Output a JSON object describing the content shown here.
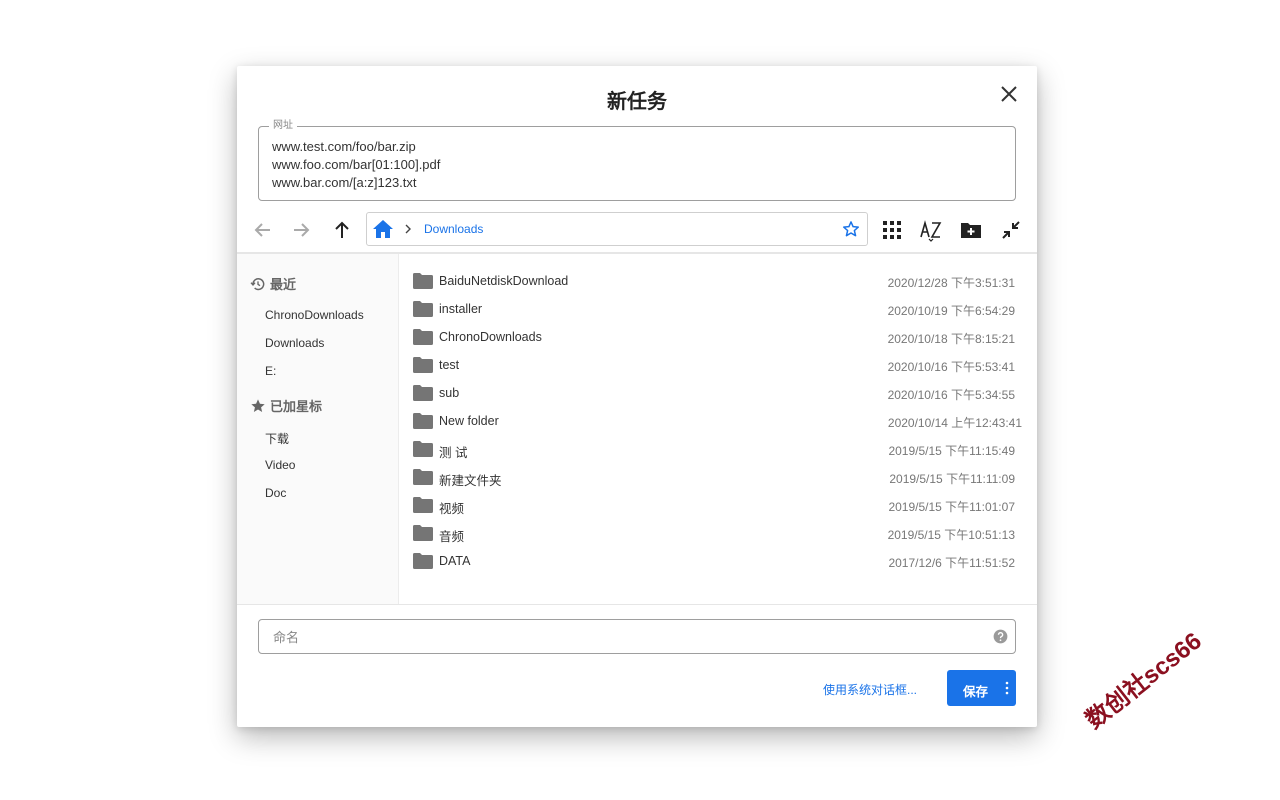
{
  "dialog": {
    "title": "新任务",
    "url_field": {
      "legend": "网址",
      "value": "www.test.com/foo/bar.zip\nwww.foo.com/bar[01:100].pdf\nwww.bar.com/[a:z]123.txt"
    },
    "path": {
      "segments": [
        "Downloads"
      ]
    },
    "icons": {
      "back": "arrow-left-icon",
      "forward": "arrow-right-icon",
      "up": "arrow-up-icon",
      "home": "home-icon",
      "star": "star-outline-icon",
      "grid": "grid-view-icon",
      "sort": "sort-az-icon",
      "new_folder": "new-folder-icon",
      "collapse": "collapse-icon",
      "close": "close-icon",
      "help": "help-circle-icon",
      "more": "more-vertical-icon"
    },
    "sidebar": {
      "recent_heading": "最近",
      "recent_items": [
        "ChronoDownloads",
        "Downloads",
        "E:"
      ],
      "starred_heading": "已加星标",
      "starred_items": [
        "下载",
        "Video",
        "Doc"
      ]
    },
    "files": [
      {
        "name": "BaiduNetdiskDownload",
        "date": "2020/12/28 下午3:51:31"
      },
      {
        "name": "installer",
        "date": "2020/10/19 下午6:54:29"
      },
      {
        "name": "ChronoDownloads",
        "date": "2020/10/18 下午8:15:21"
      },
      {
        "name": "test",
        "date": "2020/10/16 下午5:53:41"
      },
      {
        "name": "sub",
        "date": "2020/10/16 下午5:34:55"
      },
      {
        "name": "New folder",
        "date": "2020/10/14 上午12:43:41"
      },
      {
        "name": "测 试",
        "date": "2019/5/15 下午11:15:49"
      },
      {
        "name": "新建文件夹",
        "date": "2019/5/15 下午11:11:09"
      },
      {
        "name": "视频",
        "date": "2019/5/15 下午11:01:07"
      },
      {
        "name": "音频",
        "date": "2019/5/15 下午10:51:13"
      },
      {
        "name": "DATA",
        "date": "2017/12/6 下午11:51:52"
      }
    ],
    "name_field": {
      "placeholder": "命名",
      "value": ""
    },
    "system_dialog_link": "使用系统对话框...",
    "save_label": "保存",
    "colors": {
      "accent": "#1a73e8",
      "folder": "#757575"
    }
  },
  "watermark": "数创社scs66"
}
